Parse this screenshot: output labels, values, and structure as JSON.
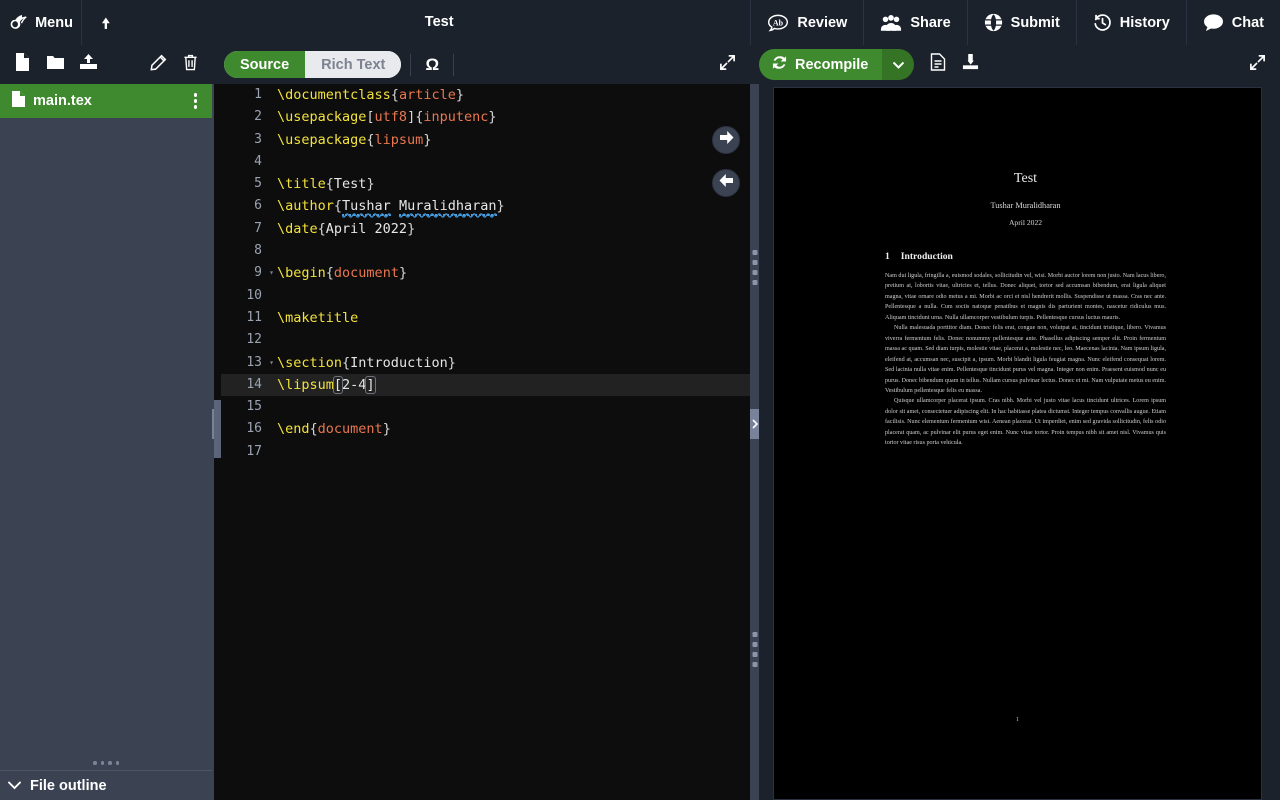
{
  "topbar": {
    "menu_label": "Menu",
    "project_title": "Test",
    "upload_icon": "upload-arrow-icon",
    "actions": [
      {
        "label": "Review",
        "icon": "review-ab-icon"
      },
      {
        "label": "Share",
        "icon": "users-icon"
      },
      {
        "label": "Submit",
        "icon": "globe-icon"
      },
      {
        "label": "History",
        "icon": "history-clock-icon"
      },
      {
        "label": "Chat",
        "icon": "chat-bubble-icon"
      }
    ]
  },
  "file_toolbar": {
    "new_file": "new-file-icon",
    "new_folder": "new-folder-icon",
    "upload": "upload-icon",
    "rename": "pencil-icon",
    "delete": "trash-icon"
  },
  "editor_toolbar": {
    "mode_toggle": {
      "active": "Source",
      "inactive": "Rich Text"
    },
    "symbol_palette": "Ω",
    "expand": "expand-arrows-icon"
  },
  "pdf_toolbar": {
    "recompile_label": "Recompile",
    "recompile_icon": "refresh-icon",
    "caret": "chevron-down-icon",
    "logs_icon": "document-logs-icon",
    "download_icon": "download-icon",
    "expand": "expand-arrows-icon",
    "accent_color": "#3f8a2e"
  },
  "sidebar": {
    "file": {
      "name": "main.tex",
      "icon": "file-icon",
      "selected": true,
      "menu": "kebab-menu-icon"
    },
    "file_outline_label": "File outline",
    "outline_caret": "chevron-down-icon",
    "selected_color": "#3f8a2e"
  },
  "editor": {
    "active_line": 14,
    "nav_forward": "arrow-right-circle-icon",
    "nav_back": "arrow-left-circle-icon",
    "lines": [
      {
        "n": 1,
        "fold": false,
        "tokens": [
          {
            "t": "\\documentclass",
            "c": "k"
          },
          {
            "t": "{",
            "c": "br"
          },
          {
            "t": "article",
            "c": "a"
          },
          {
            "t": "}",
            "c": "br"
          }
        ]
      },
      {
        "n": 2,
        "fold": false,
        "tokens": [
          {
            "t": "\\usepackage",
            "c": "k"
          },
          {
            "t": "[",
            "c": "br"
          },
          {
            "t": "utf8",
            "c": "opt"
          },
          {
            "t": "]",
            "c": "br"
          },
          {
            "t": "{",
            "c": "br"
          },
          {
            "t": "inputenc",
            "c": "a"
          },
          {
            "t": "}",
            "c": "br"
          }
        ]
      },
      {
        "n": 3,
        "fold": false,
        "tokens": [
          {
            "t": "\\usepackage",
            "c": "k"
          },
          {
            "t": "{",
            "c": "br"
          },
          {
            "t": "lipsum",
            "c": "a"
          },
          {
            "t": "}",
            "c": "br"
          }
        ]
      },
      {
        "n": 4,
        "fold": false,
        "tokens": []
      },
      {
        "n": 5,
        "fold": false,
        "tokens": [
          {
            "t": "\\title",
            "c": "k"
          },
          {
            "t": "{",
            "c": "br"
          },
          {
            "t": "Test",
            "c": "o"
          },
          {
            "t": "}",
            "c": "br"
          }
        ]
      },
      {
        "n": 6,
        "fold": false,
        "tokens": [
          {
            "t": "\\author",
            "c": "k"
          },
          {
            "t": "{",
            "c": "br"
          },
          {
            "t": "Tushar",
            "c": "spell"
          },
          {
            "t": " ",
            "c": "o"
          },
          {
            "t": "Muralidharan",
            "c": "spell"
          },
          {
            "t": "}",
            "c": "br"
          }
        ]
      },
      {
        "n": 7,
        "fold": false,
        "tokens": [
          {
            "t": "\\date",
            "c": "k"
          },
          {
            "t": "{",
            "c": "br"
          },
          {
            "t": "April 2022",
            "c": "o"
          },
          {
            "t": "}",
            "c": "br"
          }
        ]
      },
      {
        "n": 8,
        "fold": false,
        "tokens": []
      },
      {
        "n": 9,
        "fold": true,
        "tokens": [
          {
            "t": "\\begin",
            "c": "k"
          },
          {
            "t": "{",
            "c": "br"
          },
          {
            "t": "document",
            "c": "a"
          },
          {
            "t": "}",
            "c": "br"
          }
        ]
      },
      {
        "n": 10,
        "fold": false,
        "tokens": []
      },
      {
        "n": 11,
        "fold": false,
        "tokens": [
          {
            "t": "\\maketitle",
            "c": "k"
          }
        ]
      },
      {
        "n": 12,
        "fold": false,
        "tokens": []
      },
      {
        "n": 13,
        "fold": true,
        "tokens": [
          {
            "t": "\\section",
            "c": "k"
          },
          {
            "t": "{",
            "c": "br"
          },
          {
            "t": "Introduction",
            "c": "o"
          },
          {
            "t": "}",
            "c": "br"
          }
        ]
      },
      {
        "n": 14,
        "fold": false,
        "tokens": [
          {
            "t": "\\lipsum",
            "c": "k"
          },
          {
            "t": "[",
            "c": "bmark"
          },
          {
            "t": "2-4",
            "c": "o"
          },
          {
            "t": "]",
            "c": "bmark"
          }
        ]
      },
      {
        "n": 15,
        "fold": false,
        "tokens": []
      },
      {
        "n": 16,
        "fold": false,
        "tokens": [
          {
            "t": "\\end",
            "c": "k"
          },
          {
            "t": "{",
            "c": "br"
          },
          {
            "t": "document",
            "c": "a"
          },
          {
            "t": "}",
            "c": "br"
          }
        ]
      },
      {
        "n": 17,
        "fold": false,
        "tokens": []
      }
    ]
  },
  "pdf": {
    "title": "Test",
    "author": "Tushar Muralidharan",
    "date": "April 2022",
    "section_number": "1",
    "section_title": "Introduction",
    "page_number": "1",
    "paragraphs": [
      "Nam dui ligula, fringilla a, euismod sodales, sollicitudin vel, wisi. Morbi auctor lorem non justo. Nam lacus libero, pretium at, lobortis vitae, ultricies et, tellus. Donec aliquet, tortor sed accumsan bibendum, erat ligula aliquet magna, vitae ornare odio metus a mi. Morbi ac orci et nisl hendrerit mollis. Suspendisse ut massa. Cras nec ante. Pellentesque a nulla. Cum sociis natoque penatibus et magnis dis parturient montes, nascetur ridiculus mus. Aliquam tincidunt urna. Nulla ullamcorper vestibulum turpis. Pellentesque cursus luctus mauris.",
      "Nulla malesuada porttitor diam. Donec felis erat, congue non, volutpat at, tincidunt tristique, libero. Vivamus viverra fermentum felis. Donec nonummy pellentesque ante. Phasellus adipiscing semper elit. Proin fermentum massa ac quam. Sed diam turpis, molestie vitae, placerat a, molestie nec, leo. Maecenas lacinia. Nam ipsum ligula, eleifend at, accumsan nec, suscipit a, ipsum. Morbi blandit ligula feugiat magna. Nunc eleifend consequat lorem. Sed lacinia nulla vitae enim. Pellentesque tincidunt purus vel magna. Integer non enim. Praesent euismod nunc eu purus. Donec bibendum quam in tellus. Nullam cursus pulvinar lectus. Donec et mi. Nam vulputate metus eu enim. Vestibulum pellentesque felis eu massa.",
      "Quisque ullamcorper placerat ipsum. Cras nibh. Morbi vel justo vitae lacus tincidunt ultrices. Lorem ipsum dolor sit amet, consectetuer adipiscing elit. In hac habitasse platea dictumst. Integer tempus convallis augue. Etiam facilisis. Nunc elementum fermentum wisi. Aenean placerat. Ut imperdiet, enim sed gravida sollicitudin, felis odio placerat quam, ac pulvinar elit purus eget enim. Nunc vitae tortor. Proin tempus nibh sit amet nisl. Vivamus quis tortor vitae risus porta vehicula."
    ]
  },
  "theme": {
    "chrome_bg": "#1b222c",
    "panel_bg": "#3b4252",
    "editor_bg": "#0d0d0d",
    "accent_green": "#3f8a2e"
  }
}
